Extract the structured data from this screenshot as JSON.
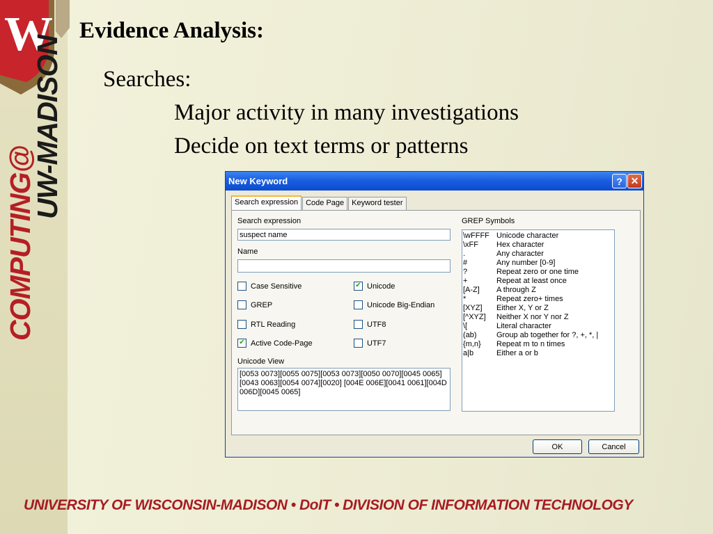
{
  "slide": {
    "title": "Evidence Analysis:",
    "bullet": "Searches:",
    "sub_bullets": [
      "Major activity in many investigations",
      "Decide on text terms or patterns"
    ],
    "side_line1": "COMPUTING@",
    "side_line2": "UW-MADISON",
    "footer": "UNIVERSITY OF WISCONSIN-MADISON • DoIT • DIVISION OF INFORMATION TECHNOLOGY",
    "logo_letter": "W"
  },
  "dialog": {
    "title": "New Keyword",
    "help_glyph": "?",
    "close_glyph": "✕",
    "tabs": [
      "Search expression",
      "Code Page",
      "Keyword tester"
    ],
    "search_expression_label": "Search expression",
    "search_expression_value": "suspect name",
    "name_label": "Name",
    "name_value": "",
    "options_left": [
      {
        "label": "Case Sensitive",
        "checked": false
      },
      {
        "label": "GREP",
        "checked": false
      },
      {
        "label": "RTL Reading",
        "checked": false
      },
      {
        "label": "Active Code-Page",
        "checked": true
      }
    ],
    "options_right": [
      {
        "label": "Unicode",
        "checked": true
      },
      {
        "label": "Unicode Big-Endian",
        "checked": false
      },
      {
        "label": "UTF8",
        "checked": false
      },
      {
        "label": "UTF7",
        "checked": false
      }
    ],
    "unicode_view_label": "Unicode View",
    "unicode_view_text": "[0053 0073][0055 0075][0053 0073][0050 0070][0045 0065][0043 0063][0054 0074][0020] [004E 006E][0041 0061][004D 006D][0045 0065]",
    "grep_label": "GREP Symbols",
    "grep_symbols": [
      {
        "sym": "\\wFFFF",
        "desc": "Unicode character"
      },
      {
        "sym": "\\xFF",
        "desc": "Hex character"
      },
      {
        "sym": ".",
        "desc": "Any character"
      },
      {
        "sym": "#",
        "desc": "Any number [0-9]"
      },
      {
        "sym": "?",
        "desc": "Repeat zero or one time"
      },
      {
        "sym": "+",
        "desc": "Repeat at least once"
      },
      {
        "sym": "[A-Z]",
        "desc": "A through Z"
      },
      {
        "sym": "*",
        "desc": "Repeat zero+ times"
      },
      {
        "sym": "[XYZ]",
        "desc": "Either X, Y or Z"
      },
      {
        "sym": "[^XYZ]",
        "desc": "Neither X nor Y nor Z"
      },
      {
        "sym": "\\[",
        "desc": "Literal character"
      },
      {
        "sym": "(ab)",
        "desc": "Group ab together for ?, +, *, |"
      },
      {
        "sym": "{m,n}",
        "desc": "Repeat m to n times"
      },
      {
        "sym": "a|b",
        "desc": "Either a or b"
      }
    ],
    "ok_label": "OK",
    "cancel_label": "Cancel"
  }
}
